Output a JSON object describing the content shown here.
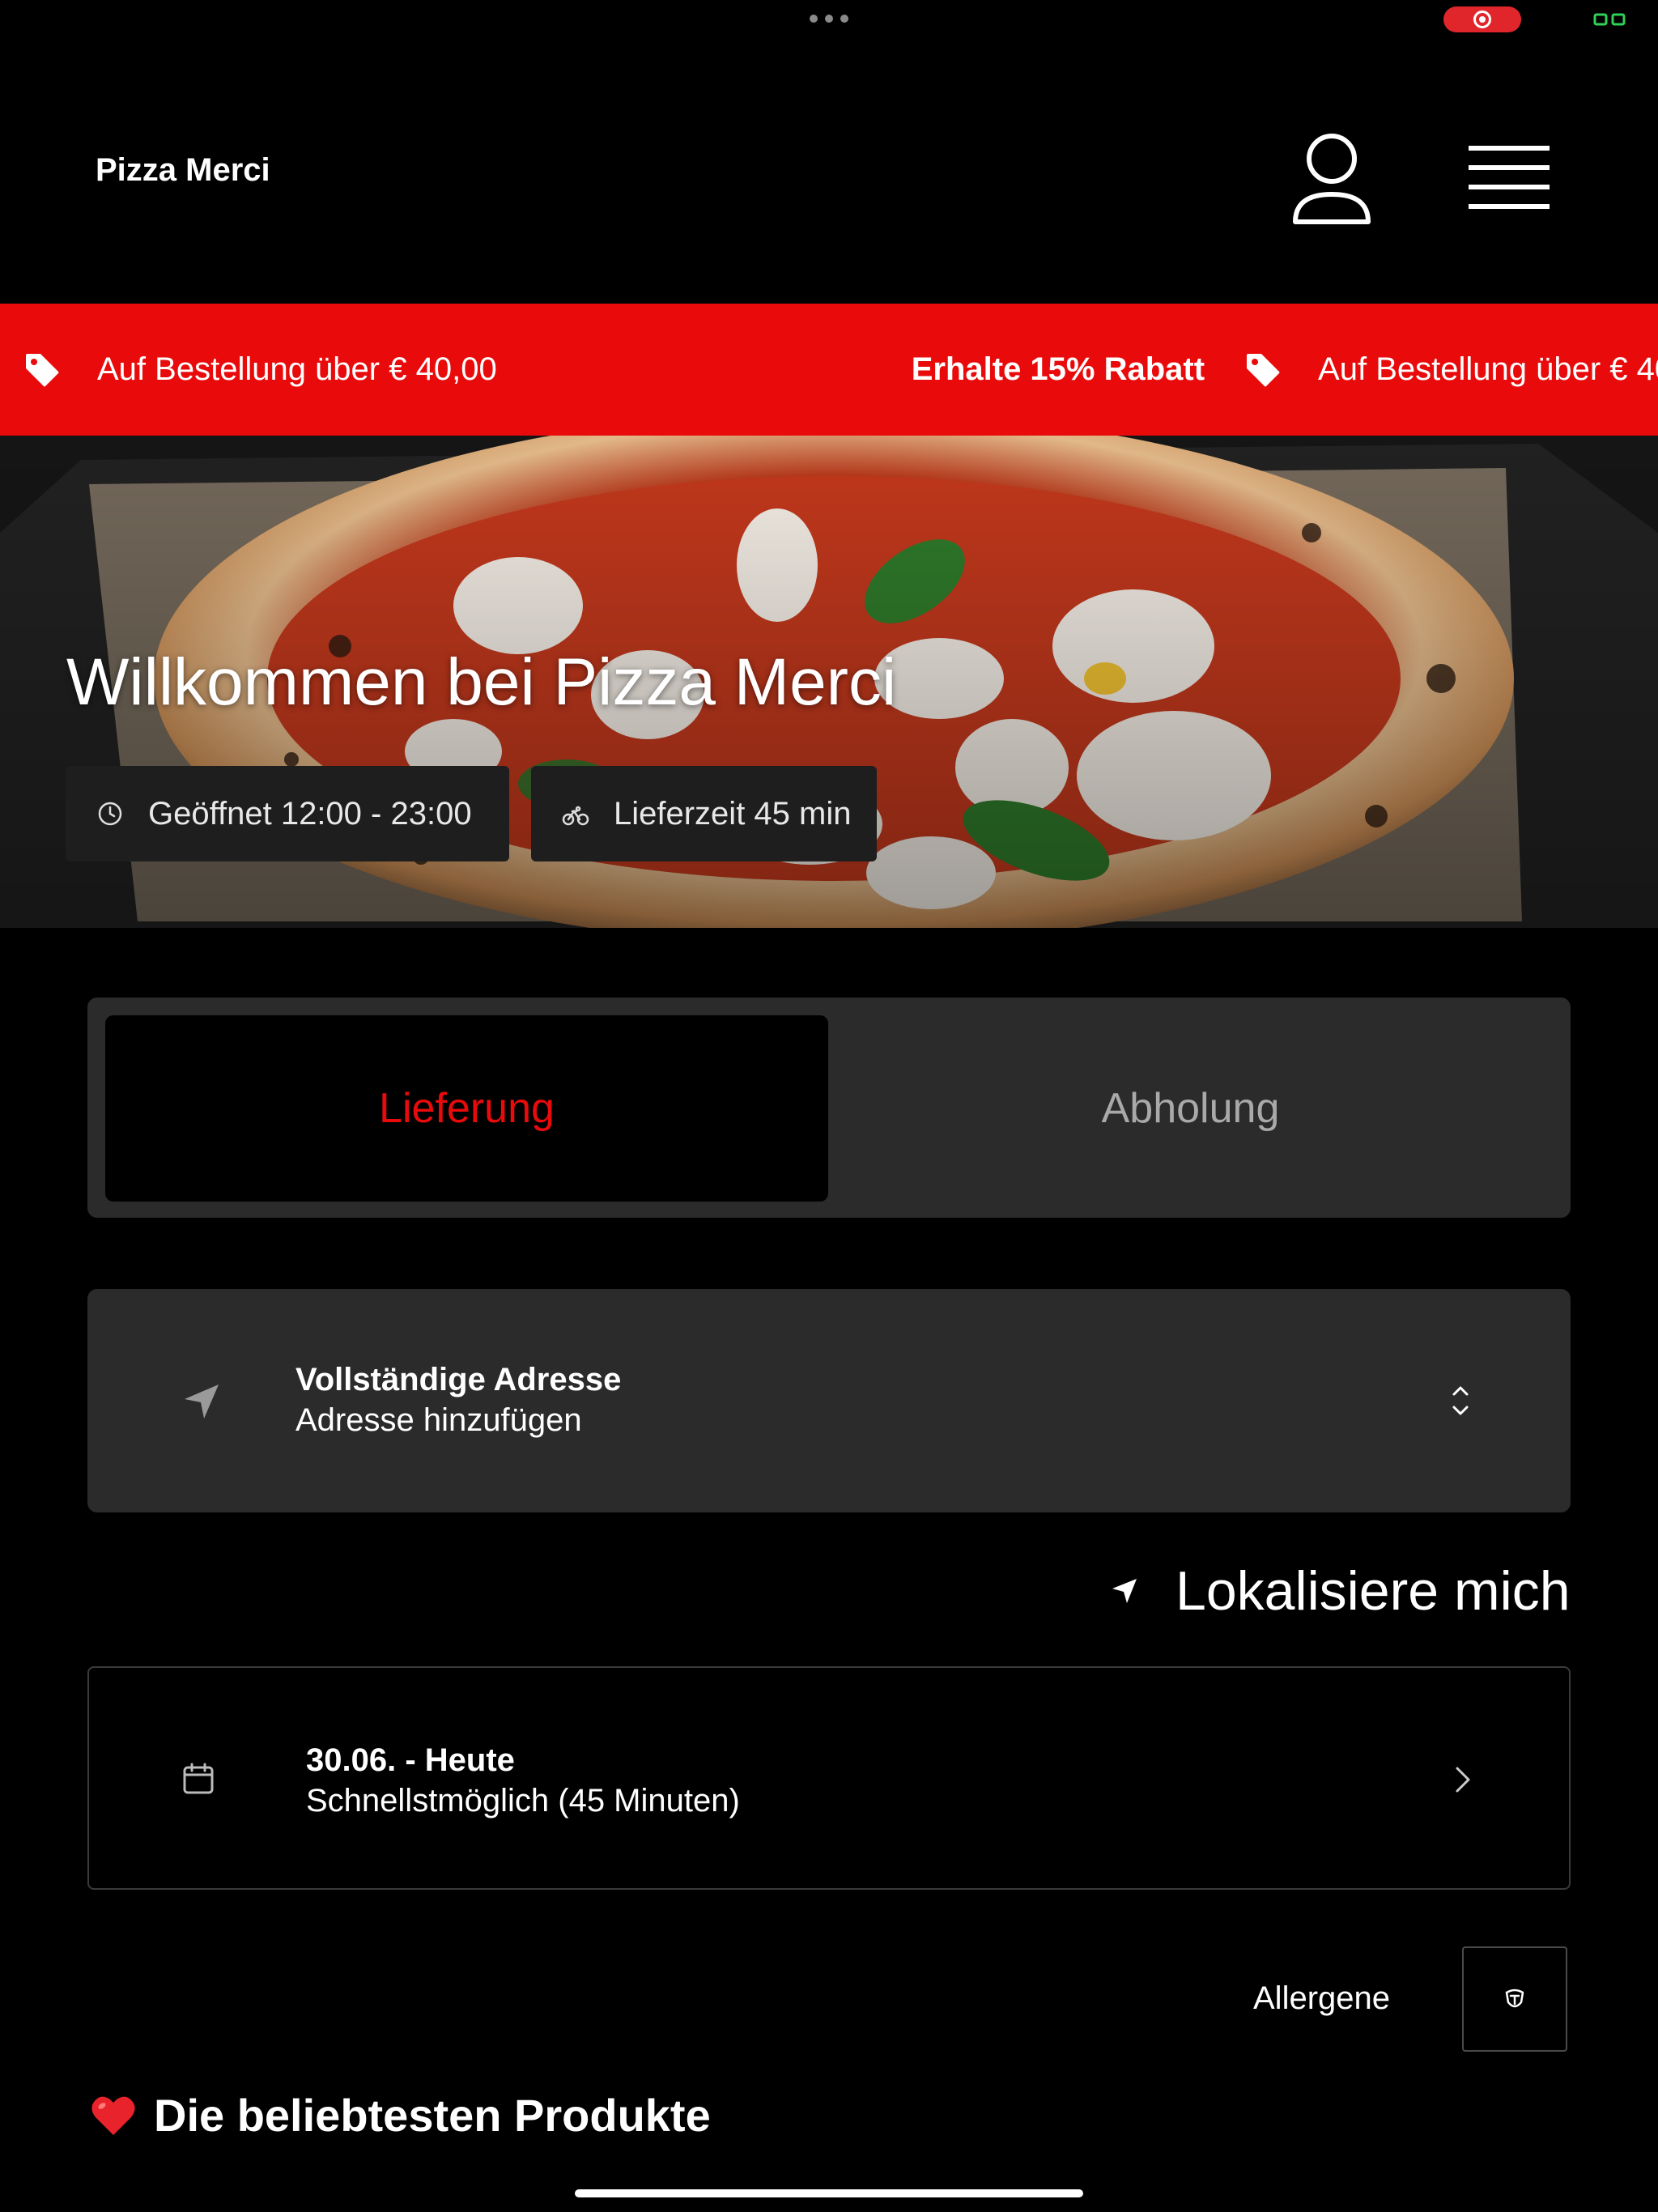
{
  "app": {
    "brand": "Pizza Merci"
  },
  "promo": {
    "line": "Auf Bestellung über € 40,00",
    "highlight": "Erhalte 15% Rabatt",
    "line_repeat": "Auf Bestellung über € 40,00",
    "color": "#e90b0b"
  },
  "hero": {
    "title": "Willkommen bei Pizza Merci",
    "opening": "Geöffnet 12:00 - 23:00",
    "delivery_time": "Lieferzeit 45 min"
  },
  "order_mode": {
    "options": [
      "Lieferung",
      "Abholung"
    ],
    "selected": "Lieferung",
    "active_color": "#e90b0b"
  },
  "address": {
    "title": "Vollständige Adresse",
    "subtitle": "Adresse hinzufügen"
  },
  "locate": {
    "label": "Lokalisiere mich"
  },
  "schedule": {
    "title": "30.06. - Heute",
    "subtitle": "Schnellstmöglich (45 Minuten)"
  },
  "allergens": {
    "label": "Allergene"
  },
  "section": {
    "title": "Die beliebtesten Produkte"
  },
  "icons": [
    "profile-icon",
    "menu-icon",
    "tag-icon",
    "clock-icon",
    "bicycle-icon",
    "location-arrow-icon",
    "chevron-up-down-icon",
    "calendar-icon",
    "chevron-right-icon",
    "allergen-icon",
    "heart-icon"
  ]
}
